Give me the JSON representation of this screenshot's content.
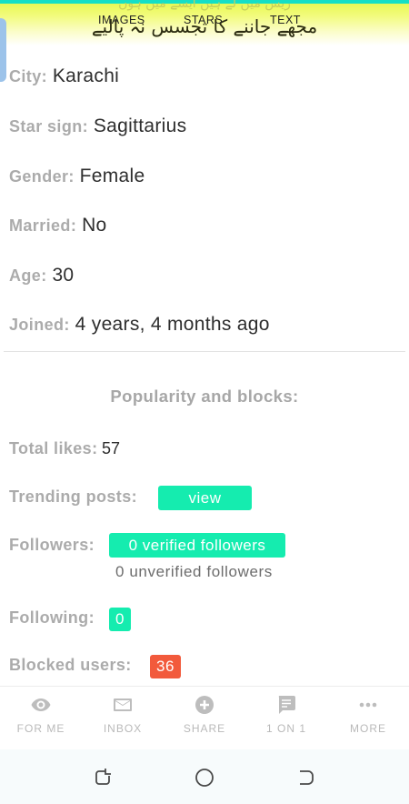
{
  "header": {
    "faint_text": "ریس میں لے ہیں ایسے میں ہوں",
    "urdu_text": "مجھے جاننے کا تجسس نہ پالیے",
    "tabs": [
      "IMAGES",
      "STARS",
      "TEXT"
    ]
  },
  "profile": [
    {
      "label": "City:",
      "value": "Karachi"
    },
    {
      "label": "Star sign:",
      "value": "Sagittarius"
    },
    {
      "label": "Gender:",
      "value": "Female"
    },
    {
      "label": "Married:",
      "value": "No"
    },
    {
      "label": "Age:",
      "value": "30"
    },
    {
      "label": "Joined:",
      "value": "4 years, 4 months ago"
    }
  ],
  "popularity": {
    "title": "Popularity and blocks:",
    "total_likes_label": "Total likes:",
    "total_likes_value": "57",
    "trending_label": "Trending posts:",
    "trending_button": "view",
    "followers_label": "Followers:",
    "verified_followers": "0 verified followers",
    "unverified_followers": "0 unverified followers",
    "following_label": "Following:",
    "following_count": "0",
    "blocked_label": "Blocked users:",
    "blocked_count": "36"
  },
  "bottom_nav": [
    {
      "label": "FOR ME",
      "icon": "eye-icon"
    },
    {
      "label": "INBOX",
      "icon": "mail-icon"
    },
    {
      "label": "SHARE",
      "icon": "plus-circle-icon"
    },
    {
      "label": "1 ON 1",
      "icon": "chat-icon"
    },
    {
      "label": "MORE",
      "icon": "more-dots-icon"
    }
  ],
  "system_nav": [
    "recents-icon",
    "home-icon",
    "back-icon"
  ],
  "colors": {
    "accent": "#15ecaf",
    "danger": "#f25a3c",
    "label_gray": "#ababab",
    "banner_yellow": "#e6f84a"
  }
}
